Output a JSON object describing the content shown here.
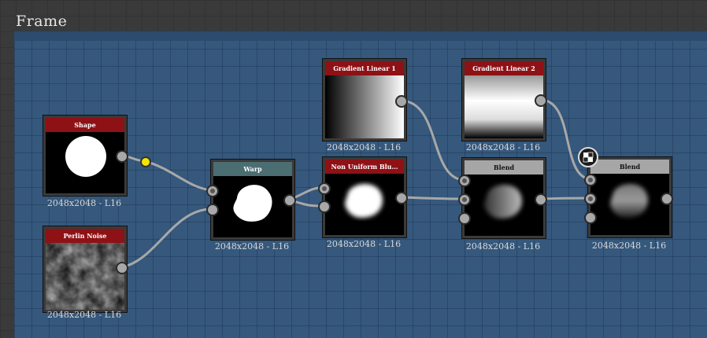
{
  "frame": {
    "title": "Frame"
  },
  "colors": {
    "frame_bg": "#35587c",
    "header_red": "#8e1116",
    "header_warp": "#4b6e72",
    "header_blend": "#a6a6a6",
    "wire": "#a8a8a8",
    "pin_yellow": "#f2e500"
  },
  "nodes": [
    {
      "id": "shape",
      "label": "Shape",
      "resolution": "2048x2048 - L16",
      "header": "red",
      "thumb": "white-disc"
    },
    {
      "id": "perlin-noise",
      "label": "Perlin Noise",
      "resolution": "2048x2048 - L16",
      "header": "red",
      "thumb": "noise"
    },
    {
      "id": "warp",
      "label": "Warp",
      "resolution": "2048x2048 - L16",
      "header": "warp",
      "thumb": "warped-blob"
    },
    {
      "id": "gradient-linear-1",
      "label": "Gradient Linear 1",
      "resolution": "2048x2048 - L16",
      "header": "red",
      "thumb": "gradient-horizontal"
    },
    {
      "id": "non-uniform-blur",
      "label": "Non Uniform Blu…",
      "resolution": "2048x2048 - L16",
      "header": "red",
      "thumb": "blurred-blob"
    },
    {
      "id": "gradient-linear-2",
      "label": "Gradient Linear 2",
      "resolution": "2048x2048 - L16",
      "header": "red",
      "thumb": "gradient-vertical"
    },
    {
      "id": "blend-1",
      "label": "Blend",
      "resolution": "2048x2048 - L16",
      "header": "blend",
      "thumb": "grey-blob"
    },
    {
      "id": "blend-2",
      "label": "Blend",
      "resolution": "2048x2048 - L16",
      "header": "blend",
      "thumb": "grey-blob"
    }
  ],
  "icons": {
    "comment": "checker-comment-icon",
    "reroute": "yellow-dot-icon"
  }
}
